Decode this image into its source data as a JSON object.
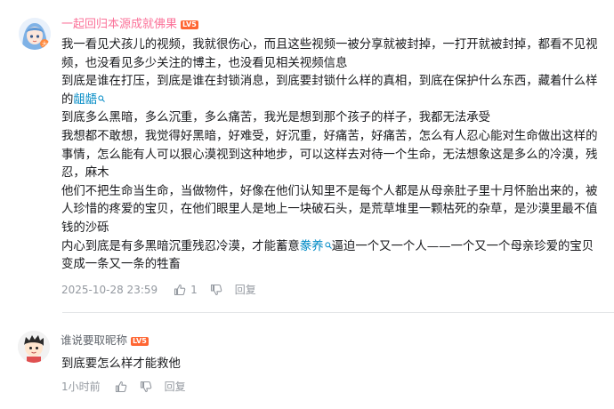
{
  "comments": [
    {
      "user": {
        "name": "一起回归本源成就佛果",
        "level": "LV5",
        "name_color": "#fb7299"
      },
      "paragraphs": [
        "我一看见犬孩儿的视频，我就很伤心，而且这些视频一被分享就被封掉，一打开就被封掉，都看不见视频，也没看见多少关注的博主，也没看见相关视频信息",
        "到底是谁在打压，到底是谁在封锁消息，到底要封锁什么样的真相，到底在保护什么东西，藏着什么样的",
        "到底多么黑暗，多么沉重，多么痛苦，我光是想到那个孩子的样子，我都无法承受",
        "我想都不敢想，我觉得好黑暗，好难受，好沉重，好痛苦，好痛苦，怎么有人忍心能对生命做出这样的事情，怎么能有人可以狠心漠视到这种地步，可以这样去对待一个生命，无法想象这是多么的冷漠，残忍，麻木",
        "他们不把生命当生命，当做物件，好像在他们认知里不是每个人都是从母亲肚子里十月怀胎出来的，被人珍惜的疼爱的宝贝，在他们眼里人是地上一块破石头，是荒草堆里一颗枯死的杂草，是沙漠里最不值钱的沙砾",
        "内心到底是有多黑暗沉重残忍冷漠，才能蓄意",
        "逼迫一个又一个人——一个又一个母亲珍爱的宝贝变成一条又一条的牲畜"
      ],
      "link_1": "龃龉",
      "link_2": "豢养",
      "timestamp": "2025-10-28 23:59",
      "likes": "1",
      "reply_label": "回复"
    },
    {
      "user": {
        "name": "谁说要取昵称",
        "level": "LV5",
        "name_color": "#61666d"
      },
      "paragraphs": [
        "到底要怎么样才能救他"
      ],
      "timestamp": "1小时前",
      "reply_label": "回复"
    }
  ],
  "colors": {
    "link": "#008ac5",
    "level_badge": "#ff6633",
    "meta": "#9499a0"
  },
  "icons": [
    "search-icon",
    "thumbs-up-icon",
    "thumbs-down-icon",
    "avatar-anime-girl",
    "avatar-cartoon-boy"
  ]
}
